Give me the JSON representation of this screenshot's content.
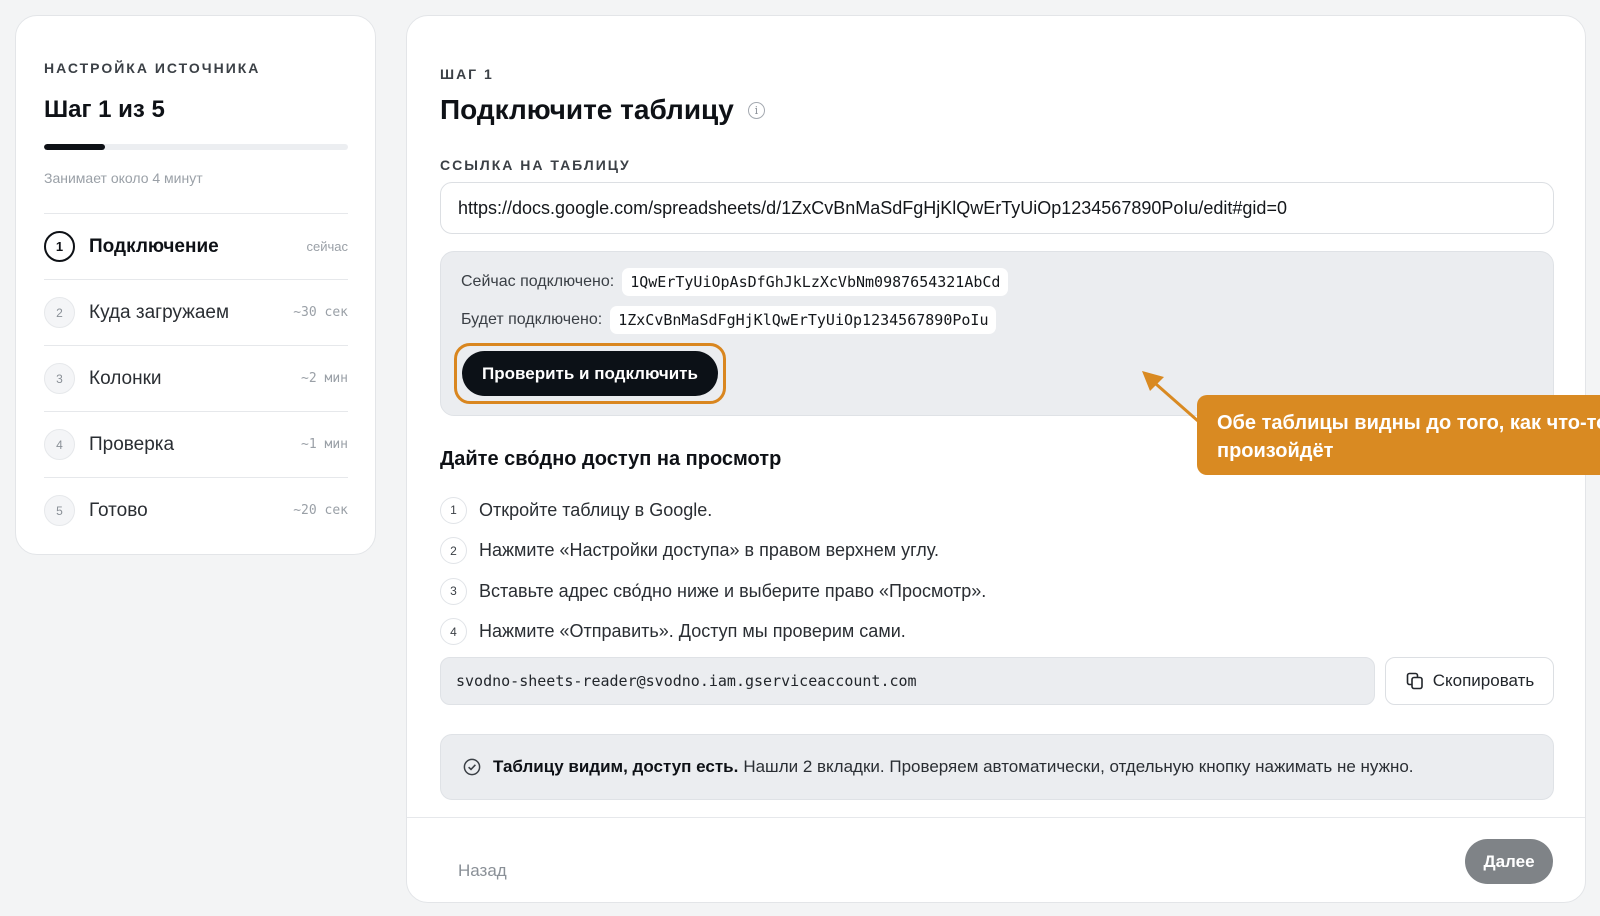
{
  "sidebar": {
    "eyebrow": "НАСТРОЙКА ИСТОЧНИКА",
    "title": "Шаг 1 из 5",
    "progress": 0.2,
    "duration": "Занимает около 4 минут",
    "steps": [
      {
        "num": "1",
        "label": "Подключение",
        "time": "сейчас",
        "active": true
      },
      {
        "num": "2",
        "label": "Куда загружаем",
        "time": "~30 сек",
        "active": false
      },
      {
        "num": "3",
        "label": "Колонки",
        "time": "~2 мин",
        "active": false
      },
      {
        "num": "4",
        "label": "Проверка",
        "time": "~1 мин",
        "active": false
      },
      {
        "num": "5",
        "label": "Готово",
        "time": "~20 сек",
        "active": false
      }
    ]
  },
  "main": {
    "eyebrow": "ШАГ 1",
    "title": "Подключите таблицу",
    "info_icon": "i",
    "url_label": "ССЫЛКА НА ТАБЛИЦУ",
    "url_value": "https://docs.google.com/spreadsheets/d/1ZxCvBnMaSdFgHjKlQwErTyUiOp1234567890PoIu/edit#gid=0",
    "current_label": "Сейчас подключено:",
    "current_value": "1QwErTyUiOpAsDfGhJkLzXcVbNm0987654321AbCd",
    "next_label": "Будет подключено:",
    "next_value": "1ZxCvBnMaSdFgHjKlQwErTyUiOp1234567890PoIu",
    "verify_button": "Проверить и подключить",
    "callout": "Обе таблицы видны до того, как что-то произойдёт",
    "section_title": "Дайте сво́дно доступ на просмотр",
    "instructions": [
      {
        "num": "1",
        "text": "Откройте таблицу в Google."
      },
      {
        "num": "2",
        "text": "Нажмите «Настройки доступа» в правом верхнем углу."
      },
      {
        "num": "3",
        "text": "Вставьте адрес сво́дно ниже и выберите право «Просмотр»."
      },
      {
        "num": "4",
        "text": "Нажмите «Отправить». Доступ мы проверим сами."
      }
    ],
    "service_email": "svodno-sheets-reader@svodno.iam.gserviceaccount.com",
    "copy_button": "Скопировать",
    "status_strong": "Таблицу видим, доступ есть.",
    "status_text": "Нашли 2 вкладки. Проверяем автоматически, отдельную кнопку нажимать не нужно."
  },
  "footer": {
    "back_button": "Назад",
    "next_button": "Далее"
  },
  "colors": {
    "accent": "#d98a22",
    "primary": "#0c1117",
    "disabled": "#7f8387"
  }
}
